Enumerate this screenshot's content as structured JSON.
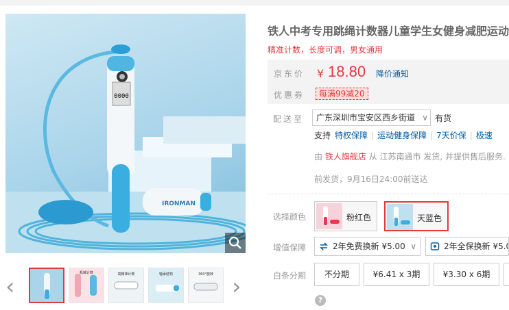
{
  "product": {
    "title": "铁人中考专用跳绳计数器儿童学生女健身减肥运动成人",
    "subtitle": "精准计数，长度可调，男女通用"
  },
  "gallery": {
    "brand_text": "IRONMAN",
    "counter_text": "0000",
    "thumbs": [
      {
        "name": "thumb-1",
        "active": true
      },
      {
        "name": "thumb-2",
        "label": "机械计数"
      },
      {
        "name": "thumb-3",
        "label": "高精准计数"
      },
      {
        "name": "thumb-4",
        "label": "轴承结构"
      },
      {
        "name": "thumb-5",
        "label": "360°旋转"
      }
    ]
  },
  "price": {
    "label": "京东价",
    "currency": "¥",
    "value": "18.80",
    "notify": "降价通知"
  },
  "promo": {
    "label": "优惠券",
    "coupon": "每满99减20"
  },
  "shipping": {
    "label": "配送至",
    "address": "广东深圳市宝安区西乡街道",
    "stock": "有货",
    "support_label": "支持",
    "services": [
      "特权保障",
      "运动健身保障",
      "7天价保",
      "极速"
    ],
    "from_prefix": "由",
    "shop": "铁人旗舰店",
    "from_suffix": "从 江苏南通市 发货, 并提供售后服务.",
    "presale": "前发货，9月16日24:00前送达"
  },
  "color": {
    "label": "选择颜色",
    "options": [
      {
        "name": "粉红色",
        "selected": false
      },
      {
        "name": "天蓝色",
        "selected": true
      }
    ]
  },
  "warranty": {
    "label": "增值保障",
    "options": [
      "2年免费换新 ¥5.00",
      "2年全保换新 ¥5.00"
    ]
  },
  "installment": {
    "label": "白条分期",
    "options": [
      "不分期",
      "¥6.41 x 3期",
      "¥3.30 x 6期"
    ]
  },
  "colors": {
    "accent": "#e4393c",
    "link": "#005ea7"
  }
}
